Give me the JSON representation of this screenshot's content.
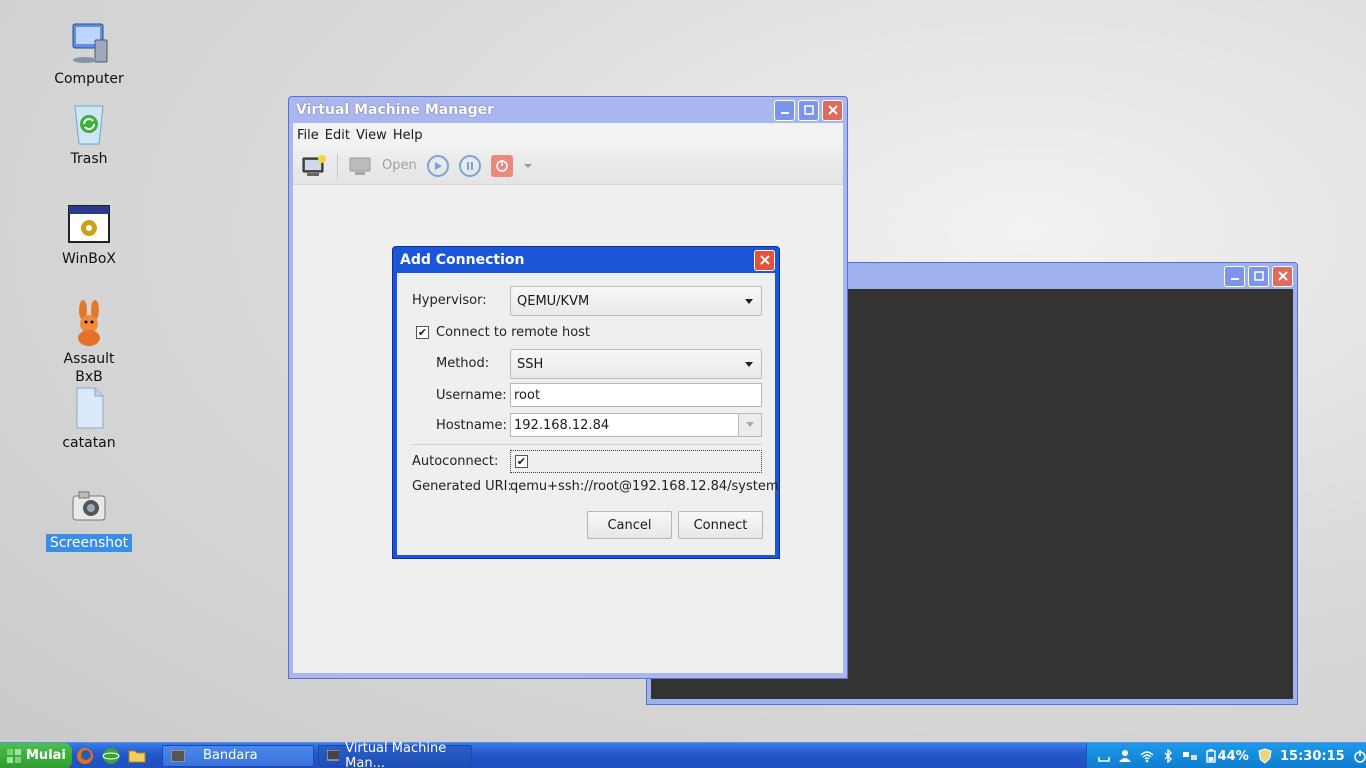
{
  "desktop": {
    "icons": [
      {
        "label": "Computer"
      },
      {
        "label": "Trash"
      },
      {
        "label": "WinBoX"
      },
      {
        "label": "Assault BxB"
      },
      {
        "label": "catatan"
      },
      {
        "label": "Screenshot"
      }
    ]
  },
  "vmm_window": {
    "title": "Virtual Machine Manager",
    "menu": [
      "File",
      "Edit",
      "View",
      "Help"
    ],
    "toolbar": {
      "open_label": "Open"
    }
  },
  "dialog": {
    "title": "Add Connection",
    "hypervisor_label": "Hypervisor:",
    "hypervisor_value": "QEMU/KVM",
    "remote_label": "Connect to remote host",
    "method_label": "Method:",
    "method_value": "SSH",
    "username_label": "Username:",
    "username_value": "root",
    "hostname_label": "Hostname:",
    "hostname_value": "192.168.12.84",
    "autoconnect_label": "Autoconnect:",
    "uri_label": "Generated URI:",
    "uri_value": "qemu+ssh://root@192.168.12.84/system",
    "cancel_label": "Cancel",
    "connect_label": "Connect"
  },
  "taskbar": {
    "start_label": "Mulai",
    "tasks": [
      {
        "label": "Bandara"
      },
      {
        "label": "Virtual Machine Man..."
      }
    ],
    "battery": "44%",
    "clock": "15:30:15"
  },
  "colors": {
    "titlebar_active": "#1c56d8",
    "taskbar": "#2456c8",
    "start": "#2f9a2f",
    "selection": "#3a8ee6"
  }
}
